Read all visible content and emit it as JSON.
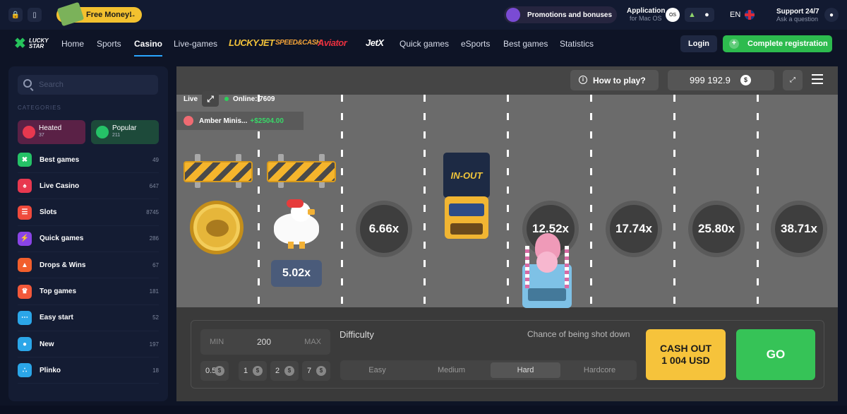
{
  "topbar": {
    "free_money": "Free Money!",
    "promotions": "Promotions and bonuses",
    "application_title": "Application",
    "application_sub": "for Mac OS",
    "os_badge": "OS",
    "language": "EN",
    "support_title": "Support 24/7",
    "support_sub": "Ask a question"
  },
  "nav": {
    "logo_line1": "LUCKY",
    "logo_line2": "STAR",
    "items": [
      "Home",
      "Sports",
      "Casino",
      "Live-games"
    ],
    "brands": [
      "LUCKYJET",
      "SPEED&CASH",
      "Aviator",
      "JetX"
    ],
    "items2": [
      "Quick games",
      "eSports",
      "Best games",
      "Statistics"
    ],
    "active": "Casino",
    "login": "Login",
    "register": "Complete registration"
  },
  "sidebar": {
    "search_placeholder": "Search",
    "categories_label": "CATEGORIES",
    "heated": {
      "label": "Heated",
      "count": "37"
    },
    "popular": {
      "label": "Popular",
      "count": "211"
    },
    "items": [
      {
        "label": "Best games",
        "count": "49",
        "color": "#25c267",
        "icon": "star-icon"
      },
      {
        "label": "Live Casino",
        "count": "647",
        "color": "#e8384f",
        "icon": "spade-icon"
      },
      {
        "label": "Slots",
        "count": "8745",
        "color": "#ef4a3c",
        "icon": "slot-icon"
      },
      {
        "label": "Quick games",
        "count": "286",
        "color": "#8a44e6",
        "icon": "lightning-icon"
      },
      {
        "label": "Drops & Wins",
        "count": "67",
        "color": "#f25f2c",
        "icon": "gift-icon"
      },
      {
        "label": "Top games",
        "count": "181",
        "color": "#f2583a",
        "icon": "crown-icon"
      },
      {
        "label": "Easy start",
        "count": "52",
        "color": "#2ba6e8",
        "icon": "dots-icon"
      },
      {
        "label": "New",
        "count": "197",
        "color": "#2ba6e8",
        "icon": "new-icon"
      },
      {
        "label": "Plinko",
        "count": "18",
        "color": "#2ba6e8",
        "icon": "plinko-icon"
      }
    ]
  },
  "game": {
    "how_to_play": "How to play?",
    "balance": "999 192.9",
    "currency_symbol": "$",
    "live_label": "Live",
    "online": "Online: 7609",
    "winner_name": "Amber Minis...",
    "winner_amount": "+$2504.00",
    "current_multiplier": "5.02x",
    "truck_brand": "IN-OUT",
    "multipliers": [
      "6.66x",
      "12.52x",
      "17.74x",
      "25.80x",
      "38.71x"
    ]
  },
  "controls": {
    "min": "MIN",
    "bet_value": "200",
    "max": "MAX",
    "quick_bets": [
      "0.5",
      "1",
      "2",
      "7"
    ],
    "difficulty_label": "Difficulty",
    "chance_label": "Chance of being shot down",
    "difficulties": [
      "Easy",
      "Medium",
      "Hard",
      "Hardcore"
    ],
    "selected_difficulty": "Hard",
    "cashout_line1": "CASH OUT",
    "cashout_line2": "1 004 USD",
    "go": "GO"
  }
}
